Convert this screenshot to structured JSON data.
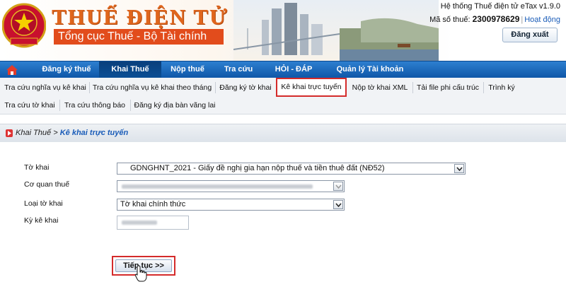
{
  "header": {
    "brand_title": "THUẾ ĐIỆN TỬ",
    "brand_subtitle": "Tổng cục Thuế - Bộ Tài chính",
    "system_name": "Hệ thống Thuế điện tử eTax v1.9.0",
    "tax_code_label": "Mã số thuế:",
    "tax_code": "2300978629",
    "activity_link": "Hoạt động",
    "logout_label": "Đăng xuất",
    "emblem_text": "THUẾ NHÀ NƯỚC",
    "brand_color": "#e0661d"
  },
  "main_nav": {
    "home_icon": "home-icon",
    "items": [
      {
        "label": "Đăng ký thuế"
      },
      {
        "label": "Khai Thuế",
        "active": true
      },
      {
        "label": "Nộp thuế"
      },
      {
        "label": "Tra cứu"
      },
      {
        "label": "HỎI - ĐÁP"
      },
      {
        "label": "Quản lý Tài khoản"
      }
    ]
  },
  "sub_nav": {
    "row1": [
      {
        "label": "Tra cứu nghĩa vụ kê khai"
      },
      {
        "label": "Tra cứu nghĩa vụ kê khai theo tháng"
      },
      {
        "label": "Đăng ký tờ khai"
      },
      {
        "label": "Kê khai trực tuyến",
        "active": true
      },
      {
        "label": "Nộp tờ khai XML"
      },
      {
        "label": "Tải file phi cấu trúc"
      },
      {
        "label": "Trình ký"
      }
    ],
    "row2": [
      {
        "label": "Tra cứu tờ khai"
      },
      {
        "label": "Tra cứu thông báo"
      },
      {
        "label": "Đăng ký địa bàn vãng lai"
      }
    ]
  },
  "breadcrumb": {
    "parent": "Khai Thuế",
    "separator": ">",
    "current": "Kê khai trực tuyến"
  },
  "form": {
    "declaration_label": "Tờ khai",
    "declaration_value": "GDNGHNT_2021 - Giấy đề nghị gia hạn nộp thuế và tiền thuê đất (NĐ52)",
    "tax_office_label": "Cơ quan thuế",
    "declaration_type_label": "Loại tờ khai",
    "declaration_type_value": "Tờ khai chính thức",
    "period_label": "Kỳ kê khai",
    "continue_button": "Tiếp tục >>"
  }
}
